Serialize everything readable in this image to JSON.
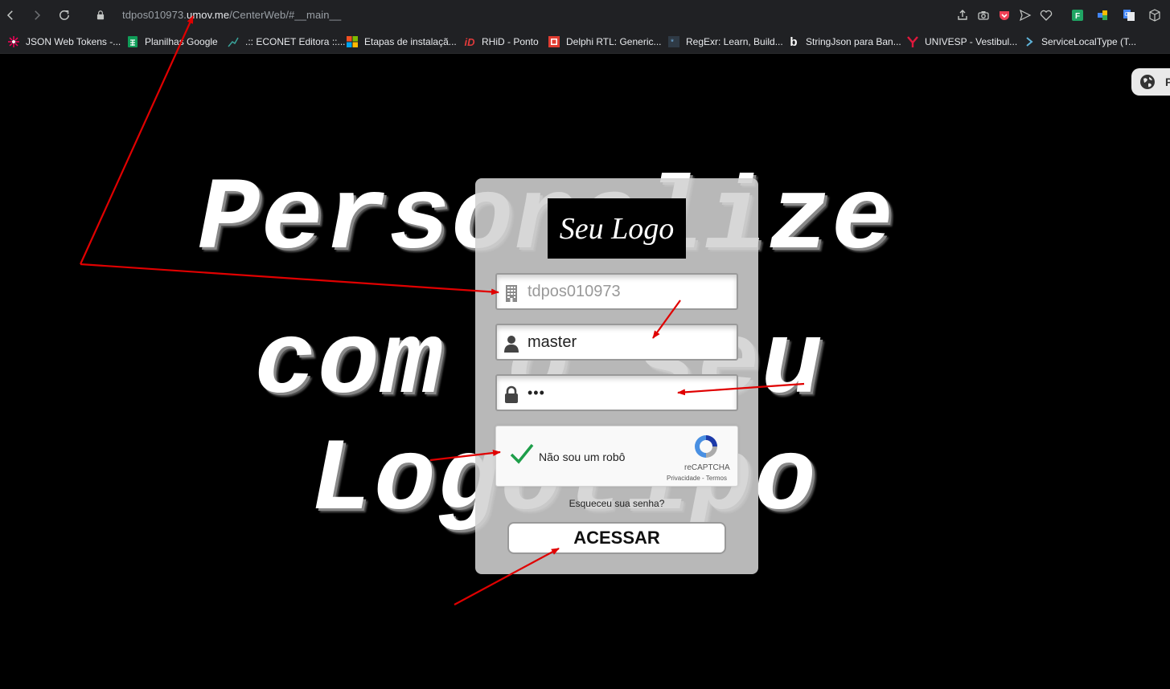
{
  "browser": {
    "url_prefix": "tdpos010973.",
    "url_domain": "umov.me",
    "url_path": "/CenterWeb/#__main__",
    "extension_icons": [
      "share-icon",
      "camera-icon",
      "pocket-icon",
      "send-icon",
      "heart-icon",
      "extension-f-icon",
      "extension-puzzle-icon",
      "translate-icon",
      "cube-icon"
    ]
  },
  "bookmarks": [
    {
      "label": "JSON Web Tokens -...",
      "icon": "jwt-icon"
    },
    {
      "label": "Planilhas Google",
      "icon": "sheets-icon"
    },
    {
      "label": ".:: ECONET Editora ::...",
      "icon": "econet-icon"
    },
    {
      "label": "Etapas de instalaçã...",
      "icon": "microsoft-icon"
    },
    {
      "label": "RHiD - Ponto",
      "icon": "rhid-icon"
    },
    {
      "label": "Delphi RTL: Generic...",
      "icon": "delphi-icon"
    },
    {
      "label": "RegExr: Learn, Build...",
      "icon": "regexr-icon"
    },
    {
      "label": "StringJson para Ban...",
      "icon": "b-icon"
    },
    {
      "label": "UNIVESP - Vestibul...",
      "icon": "univesp-icon"
    },
    {
      "label": "ServiceLocalType (T...",
      "icon": "chevron-right-icon"
    }
  ],
  "page": {
    "background_lines": [
      "Personalize",
      "com o seu",
      "Logotipo"
    ],
    "lang_label": "P"
  },
  "login": {
    "logo_text": "Seu Logo",
    "company_value": "tdpos010973",
    "username_value": "master",
    "password_value": "•••",
    "captcha_label": "Não sou um robô",
    "recaptcha_brand": "reCAPTCHA",
    "recaptcha_links": "Privacidade - Termos",
    "forgot_password": "Esqueceu sua senha?",
    "submit_label": "ACESSAR"
  },
  "colors": {
    "arrow": "#e00000",
    "card": "#d2d2d2",
    "check": "#1e9e4a"
  }
}
